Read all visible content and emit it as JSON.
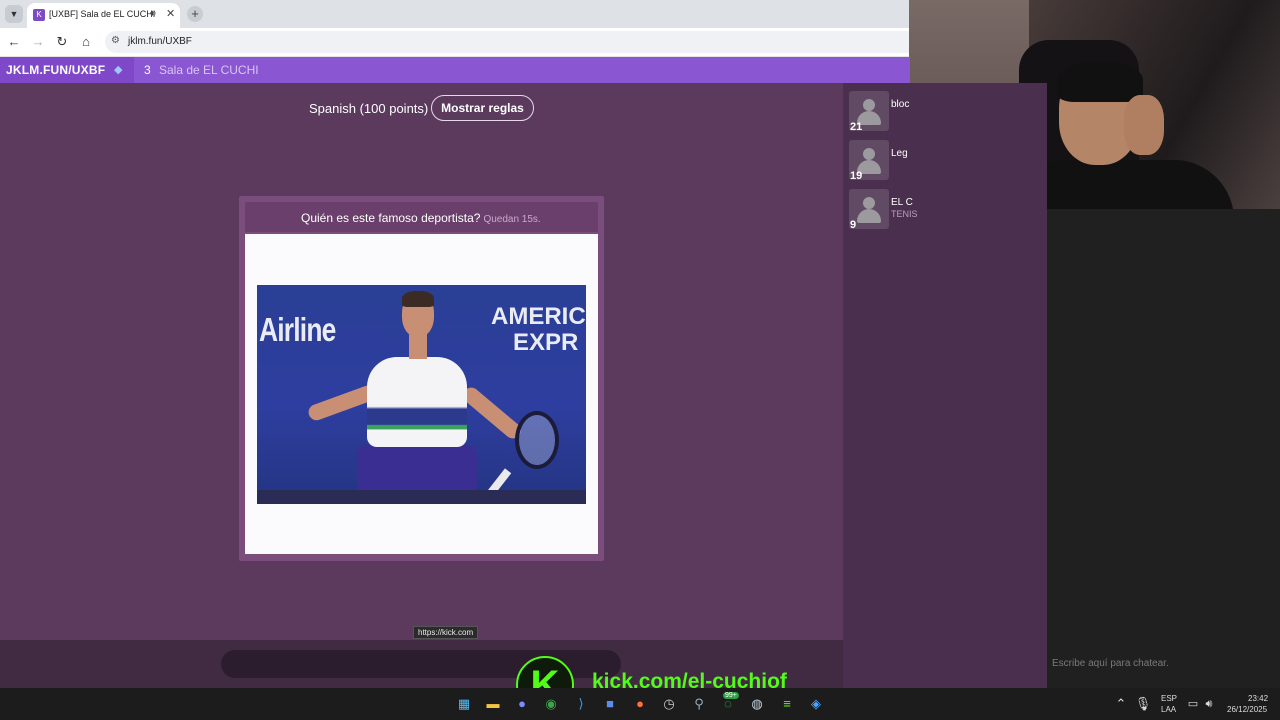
{
  "browser": {
    "tab_title": "[UXBF] Sala de EL CUCHI",
    "tab_favicon": "K",
    "url": "jklm.fun/UXBF"
  },
  "site": {
    "logo": "JKLM.FUN/UXBF",
    "room_player_count": "3",
    "room_name": "Sala de EL CUCHI",
    "accent_color": "#7f48c9"
  },
  "game": {
    "language_points": "Spanish (100 points)",
    "rules_button": "Mostrar reglas",
    "question": "Quién es este famoso deportista?",
    "timer": "Quedan 15s."
  },
  "photo_text": {
    "airline": "Airline",
    "amex_line1": "AMERIC",
    "amex_line2": "EXPR"
  },
  "players": [
    {
      "name": "bloc",
      "score": "21",
      "sub": ""
    },
    {
      "name": "Leg",
      "score": "19",
      "sub": ""
    },
    {
      "name": "EL C",
      "score": "9",
      "sub": "TENIS"
    }
  ],
  "link_tooltip": "https://kick.com",
  "chat": {
    "placeholder": "Escribe aquí para chatear."
  },
  "overlay": {
    "kick_letter": "K",
    "kick_url": "kick.com/el-cuchiof"
  },
  "taskbar": {
    "badge": "99+",
    "lang_line1": "ESP",
    "lang_line2": "LAA",
    "time": "23:42",
    "date": "26/12/2025"
  }
}
